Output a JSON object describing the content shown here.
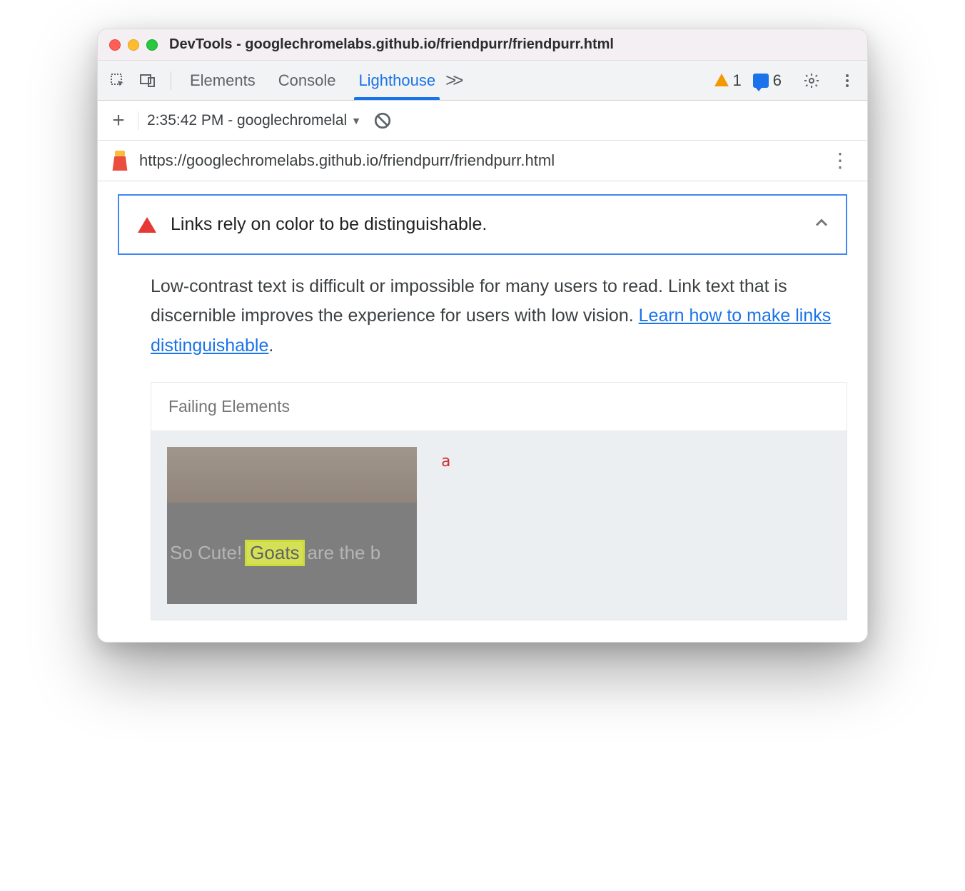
{
  "titlebar": {
    "title": "DevTools - googlechromelabs.github.io/friendpurr/friendpurr.html"
  },
  "toolbar": {
    "tabs": {
      "elements": "Elements",
      "console": "Console",
      "lighthouse": "Lighthouse"
    },
    "warning_count": "1",
    "message_count": "6"
  },
  "subbar": {
    "report_label": "2:35:42 PM - googlechromelal"
  },
  "url": {
    "text": "https://googlechromelabs.github.io/friendpurr/friendpurr.html"
  },
  "audit": {
    "title": "Links rely on color to be distinguishable.",
    "description_prefix": "Low-contrast text is difficult or impossible for many users to read. Link text that is discernible improves the experience for users with low vision. ",
    "learn_link": "Learn how to make links distinguishable",
    "description_suffix": "."
  },
  "failing": {
    "header": "Failing Elements",
    "snippet_before": "So Cute! ",
    "snippet_highlight": "Goats",
    "snippet_after": " are the b",
    "element_tag": "a"
  }
}
